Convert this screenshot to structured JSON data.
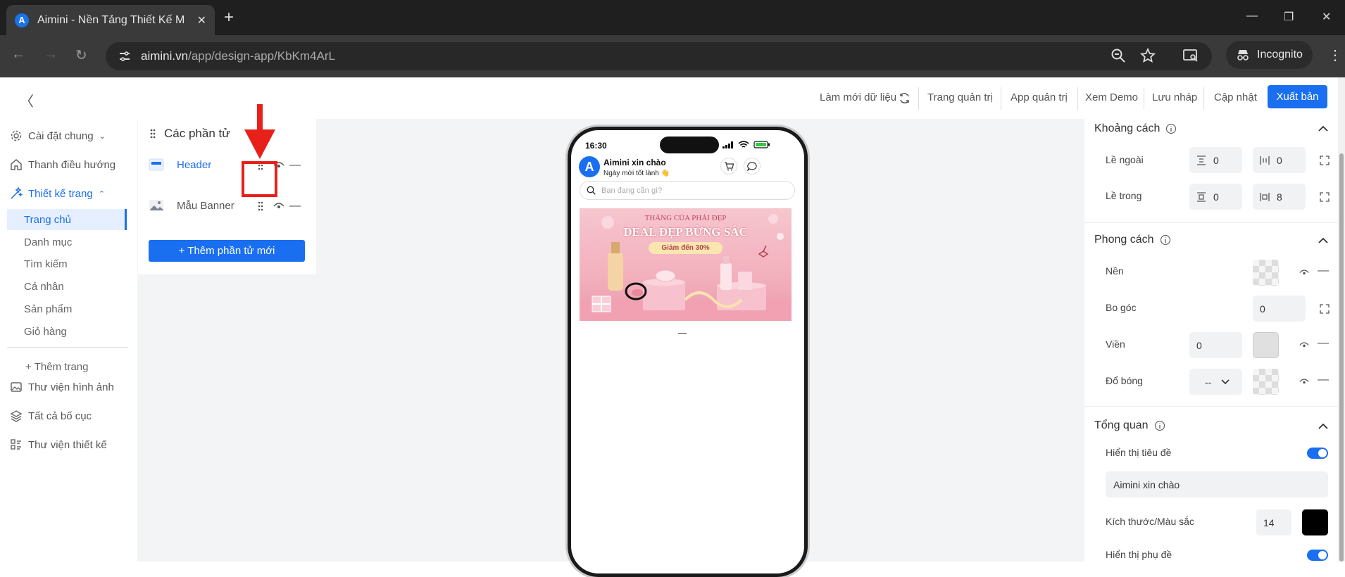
{
  "browser": {
    "tab_title": "Aimini - Nền Tảng Thiết Kế Mini",
    "favicon_letter": "A",
    "url_host": "aimini.vn",
    "url_path": "/app/design-app/KbKm4ArL",
    "incognito_label": "Incognito"
  },
  "topbar": {
    "links": [
      "Làm mới dữ liệu",
      "Trang quản trị",
      "App quản trị",
      "Xem Demo",
      "Lưu nháp",
      "Cập nhật"
    ],
    "publish_label": "Xuất bản"
  },
  "sidebar": {
    "items": [
      {
        "label": "Cài đặt chung",
        "icon": "gear-icon"
      },
      {
        "label": "Thanh điều hướng",
        "icon": "navigation-icon"
      },
      {
        "label": "Thiết kế trang",
        "icon": "magic-wand-icon"
      }
    ],
    "pages": [
      "Trang chủ",
      "Danh mục",
      "Tìm kiếm",
      "Cá nhân",
      "Sản phẩm",
      "Giỏ hàng"
    ],
    "add_page_label": "Thêm trang",
    "bottom_items": [
      {
        "label": "Thư viện hình ảnh",
        "icon": "image-library-icon"
      },
      {
        "label": "Tất cả bố cục",
        "icon": "layers-icon"
      },
      {
        "label": "Thư viện thiết kế",
        "icon": "design-library-icon"
      }
    ]
  },
  "elements_panel": {
    "title": "Các phần tử",
    "items": [
      {
        "label": "Header",
        "active": true
      },
      {
        "label": "Mẫu Banner",
        "active": false
      }
    ],
    "add_button": "+ Thêm phần tử mới"
  },
  "phone": {
    "time": "16:30",
    "avatar_letter": "A",
    "title": "Aimini xin chào",
    "subtitle": "Ngày mới tốt lành 👋",
    "search_placeholder": "Bạn đang cần gì?",
    "banner": {
      "line1": "THÁNG CỦA PHÁI ĐẸP",
      "line2": "DEAL ĐẸP BỪNG SẮC",
      "line3": "Giảm đến 30%"
    }
  },
  "right_panel": {
    "spacing": {
      "title": "Khoảng cách",
      "outer_label": "Lề ngoài",
      "outer_vertical": "0",
      "outer_horizontal": "0",
      "inner_label": "Lề trong",
      "inner_vertical": "0",
      "inner_horizontal": "8"
    },
    "style": {
      "title": "Phong cách",
      "background_label": "Nền",
      "radius_label": "Bo góc",
      "radius_value": "0",
      "border_label": "Viền",
      "border_value": "0",
      "shadow_label": "Đổ bóng",
      "shadow_value": "--"
    },
    "overview": {
      "title": "Tổng quan",
      "show_title_label": "Hiển thị tiêu đề",
      "show_title_on": true,
      "title_value": "Aimini xin chào",
      "size_color_label": "Kích thước/Màu sắc",
      "font_size": "14",
      "title_color": "#000000",
      "show_subtitle_label": "Hiển thị phụ đề",
      "show_subtitle_on": true
    }
  },
  "colors": {
    "accent": "#1a6ff0",
    "highlight": "#e8201a"
  }
}
